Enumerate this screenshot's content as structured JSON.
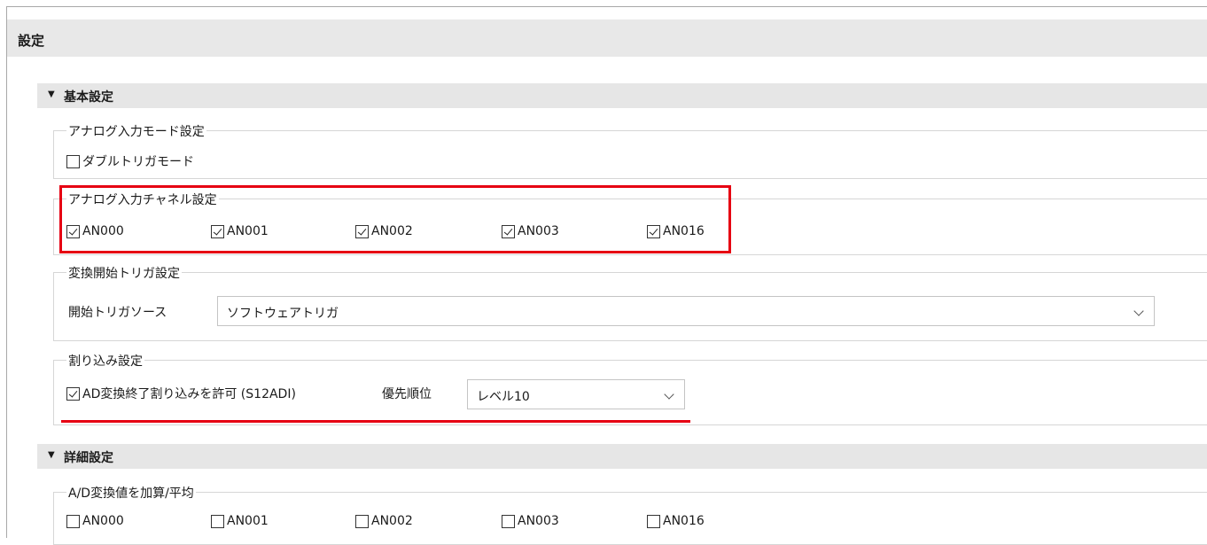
{
  "title": "設定",
  "basic": {
    "header": "基本設定",
    "analog_mode": {
      "legend": "アナログ入力モード設定",
      "double_trigger": {
        "label": "ダブルトリガモード",
        "checked": false
      }
    },
    "channels": {
      "legend": "アナログ入力チャネル設定",
      "items": [
        {
          "label": "AN000",
          "checked": true
        },
        {
          "label": "AN001",
          "checked": true
        },
        {
          "label": "AN002",
          "checked": true
        },
        {
          "label": "AN003",
          "checked": true
        },
        {
          "label": "AN016",
          "checked": true
        }
      ]
    },
    "trigger": {
      "legend": "変換開始トリガ設定",
      "source_label": "開始トリガソース",
      "source_value": "ソフトウェアトリガ"
    },
    "interrupt": {
      "legend": "割り込み設定",
      "enable": {
        "label": "AD変換終了割り込みを許可 (S12ADI)",
        "checked": true
      },
      "priority_label": "優先順位",
      "priority_value": "レベル10"
    }
  },
  "detail": {
    "header": "詳細設定",
    "add_avg": {
      "legend": "A/D変換値を加算/平均",
      "items": [
        {
          "label": "AN000",
          "checked": false
        },
        {
          "label": "AN001",
          "checked": false
        },
        {
          "label": "AN002",
          "checked": false
        },
        {
          "label": "AN003",
          "checked": false
        },
        {
          "label": "AN016",
          "checked": false
        }
      ]
    }
  },
  "colors": {
    "highlight": "#e60012",
    "section_bg": "#e6e6e6"
  }
}
